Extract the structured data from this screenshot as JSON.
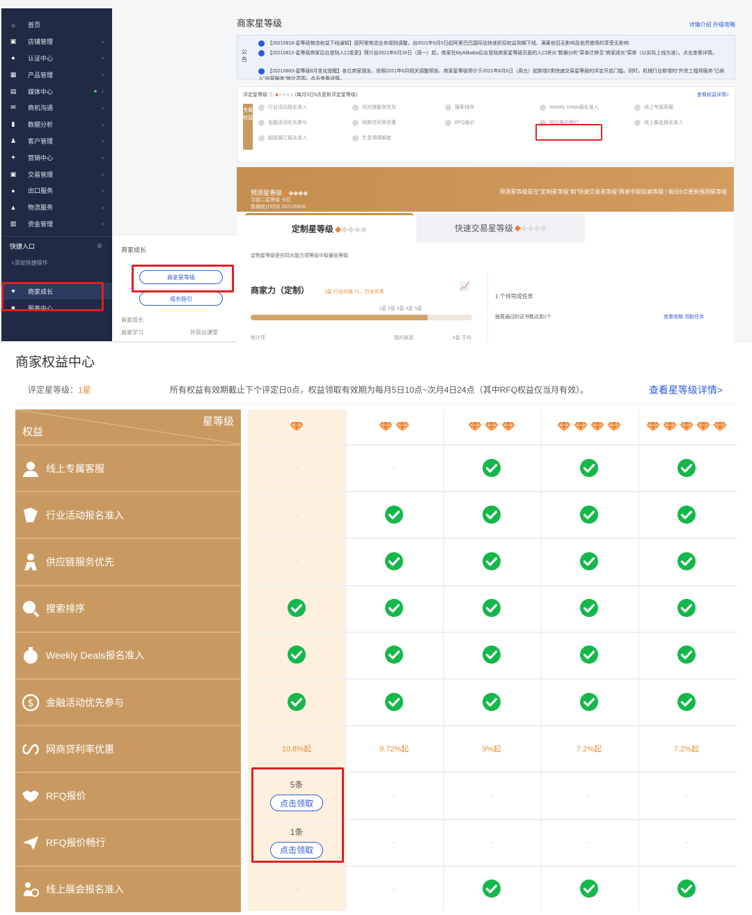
{
  "sidebar": {
    "items": [
      {
        "label": "首页",
        "icon": "home-icon",
        "arrow": false
      },
      {
        "label": "店铺管理",
        "icon": "store-icon",
        "arrow": true
      },
      {
        "label": "认证中心",
        "icon": "certificate-icon",
        "arrow": true
      },
      {
        "label": "产品管理",
        "icon": "grid-icon",
        "arrow": true
      },
      {
        "label": "媒体中心",
        "icon": "media-icon",
        "arrow": true,
        "dot": true
      },
      {
        "label": "商机沟通",
        "icon": "chat-icon",
        "arrow": true
      },
      {
        "label": "数据分析",
        "icon": "chart-icon",
        "arrow": true
      },
      {
        "label": "客户管理",
        "icon": "users-icon",
        "arrow": true
      },
      {
        "label": "营销中心",
        "icon": "marketing-icon",
        "arrow": true
      },
      {
        "label": "交易管理",
        "icon": "trade-icon",
        "arrow": true
      },
      {
        "label": "出口服务",
        "icon": "export-icon",
        "arrow": true
      },
      {
        "label": "物流服务",
        "icon": "truck-icon",
        "arrow": true
      },
      {
        "label": "资金管理",
        "icon": "bank-icon",
        "arrow": true
      }
    ],
    "quick_entry": "快捷入口",
    "add_quick": "+添加快捷操作",
    "growth": "商家成长",
    "service": "服务中心"
  },
  "popup": {
    "title": "商家成长",
    "btn_star_level": "商家星等级",
    "btn_growth_guide": "成长指引",
    "link_growth": "商家成长",
    "link_study": "商家学习",
    "link_course": "外贸云课堂"
  },
  "main_panel": {
    "title": "商家星等级",
    "links": "详情介绍  升级攻略",
    "notice_label": "公告",
    "notices": [
      "【20210818-星等级物流权益下线通知】因阿里物流业务规则调整，自2021年9月5日起阿里巴巴国际站快递折扣权益到期下线，满果依旧无影响及依然使用的享受无影响",
      "【20210812-星等级商家后台登陆入口变更】预计自2021年8月16日（周一）起，商家在MyAlibaba后台登陆商家星等级页面的入口将从\"数据分析\"菜单迁移至\"商家成长\"菜单（以实际上线为准）。点击查看详情。",
      "【20210803-星等级8月变化提醒】各位商家朋友，依照2021年6月相关调整预告，商家星等级预计于2021年8月6日（周五）起新增2类快速交易星等级的评定开启门槛，同时，机械行业新增的\"外贸工程师服务\"已纳入\"自营服务\"统计范围，点击查看详情。"
    ],
    "rights_head": "评定星等级",
    "rights_note": "(每月5日9点更新评定星等级)",
    "rights_link": "查看权益详情>",
    "rights_side": "专属权益",
    "rights_items": [
      "行业活动报名准入",
      "供应链服务优先",
      "搜索排序",
      "Weekly Deals报名准入",
      "线上专属客服",
      "金融活动优先参与",
      "网商贷利率优惠",
      "RFQ报价",
      "RFQ报价畅行",
      "线上展会报名准入",
      "超级展厅报名准入",
      "生意保障额度"
    ]
  },
  "level_card": {
    "predict_label": "预测星等级",
    "predict_sub1": "当前二星等级  卡位",
    "predict_sub2": "数据统计时间  2021/09/06",
    "predict_desc": "预测星等级是在\"定制星等级\"和\"快速交易星等级\"两者中取较高等级  |  每日9点更新预测星等级",
    "tab_custom": "定制星等级",
    "tab_fast": "快速交易星等级",
    "tip": "定制星等级是在四大能力项等级中取最低等级",
    "power_title": "商家力（定制）",
    "power_sub": "3星 行业均值 71，行业优秀",
    "power_scale": "1星       2星       3星    4星    5星",
    "power_progress": 0.8,
    "task_title": "1 个待完成任务",
    "task_item": "按真通过的证书数达到1个",
    "task_links": "查看攻略  领取任务",
    "stat_left": "统计项",
    "stat_mid": "我的表现",
    "stat_right": "4星 平均"
  },
  "rights_center": {
    "title": "商家权益中心",
    "current_label": "评定星等级：",
    "current_value": "1星",
    "validity": "所有权益有效期截止下个评定日0点，权益领取有效期为每月5日10点~次月4日24点（其中RFQ权益仅当月有效）。",
    "detail_link": "查看星等级详情>",
    "header_star": "星等级",
    "header_rights": "权益",
    "star_levels": [
      1,
      2,
      3,
      4,
      5
    ],
    "rows": [
      {
        "name": "线上专属客服",
        "icon": "agent-icon",
        "cells": [
          "-",
          "-",
          "check",
          "check",
          "check"
        ]
      },
      {
        "name": "行业活动报名准入",
        "icon": "flag-icon",
        "cells": [
          "-",
          "check",
          "check",
          "check",
          "check"
        ]
      },
      {
        "name": "供应链服务优先",
        "icon": "supply-icon",
        "cells": [
          "-",
          "check",
          "check",
          "check",
          "check"
        ]
      },
      {
        "name": "搜索排序",
        "icon": "search-icon",
        "cells": [
          "check",
          "check",
          "check",
          "check",
          "check"
        ]
      },
      {
        "name": "Weekly Deals报名准入",
        "icon": "stopwatch-icon",
        "cells": [
          "check",
          "check",
          "check",
          "check",
          "check"
        ]
      },
      {
        "name": "金融活动优先参与",
        "icon": "dollar-icon",
        "cells": [
          "check",
          "check",
          "check",
          "check",
          "check"
        ]
      },
      {
        "name": "网商贷利率优惠",
        "icon": "loan-icon",
        "cells": [
          "10.8%起",
          "9.72%起",
          "9%起",
          "7.2%起",
          "7.2%起"
        ]
      },
      {
        "name": "RFQ报价",
        "icon": "handshake-icon",
        "cells": [
          {
            "count": "5条",
            "button": "点击领取"
          },
          "-",
          "-",
          "-",
          "-"
        ]
      },
      {
        "name": "RFQ报价畅行",
        "icon": "send-icon",
        "cells": [
          {
            "count": "1条",
            "button": "点击领取"
          },
          "-",
          "-",
          "-",
          "-"
        ]
      },
      {
        "name": "线上展会报名准入",
        "icon": "expo-icon",
        "cells": [
          "-",
          "-",
          "check",
          "check",
          "check"
        ]
      }
    ]
  },
  "colors": {
    "sidebar_bg": "#1f2a44",
    "gold": "#c89a62",
    "highlight_col": "#fdf0df",
    "check_green": "#14b84a",
    "diamond": "#f0822a",
    "link_blue": "#2f5bd8",
    "annotation_red": "#e02020"
  }
}
